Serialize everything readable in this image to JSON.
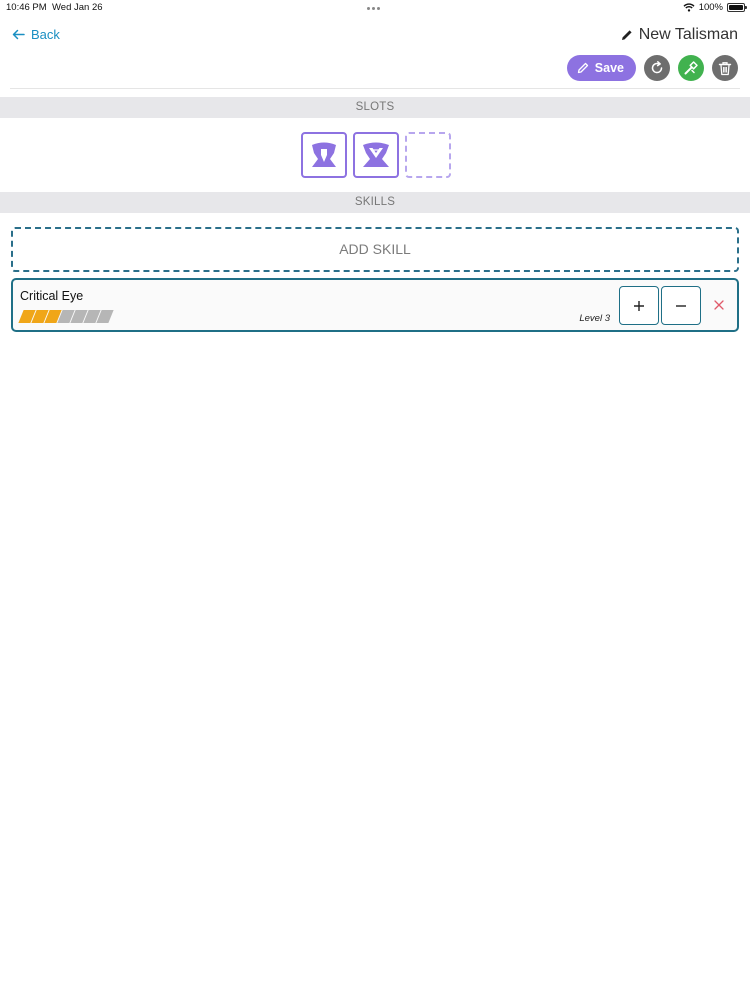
{
  "status_bar": {
    "time": "10:46 PM",
    "date": "Wed Jan 26",
    "battery": "100%"
  },
  "nav": {
    "back_label": "Back",
    "title": "New Talisman"
  },
  "toolbar": {
    "save_label": "Save"
  },
  "slots": {
    "header": "SLOTS",
    "items": [
      {
        "state": "filled",
        "icon": "slot-level-1-icon"
      },
      {
        "state": "filled",
        "icon": "slot-level-2-icon"
      },
      {
        "state": "empty",
        "icon": ""
      }
    ]
  },
  "skills": {
    "header": "SKILLS",
    "add_label": "ADD SKILL",
    "items": [
      {
        "name": "Critical Eye",
        "level_label": "Level 3",
        "level": 3,
        "max_level": 7
      }
    ]
  },
  "colors": {
    "accent": "#8d72e1",
    "link": "#1a8fc2",
    "teal_border": "#1f6f86",
    "level_on": "#f0a618",
    "level_off": "#b6b6b6",
    "green": "#41b24f",
    "grey": "#6e6e6e",
    "danger": "#e05a6a"
  }
}
